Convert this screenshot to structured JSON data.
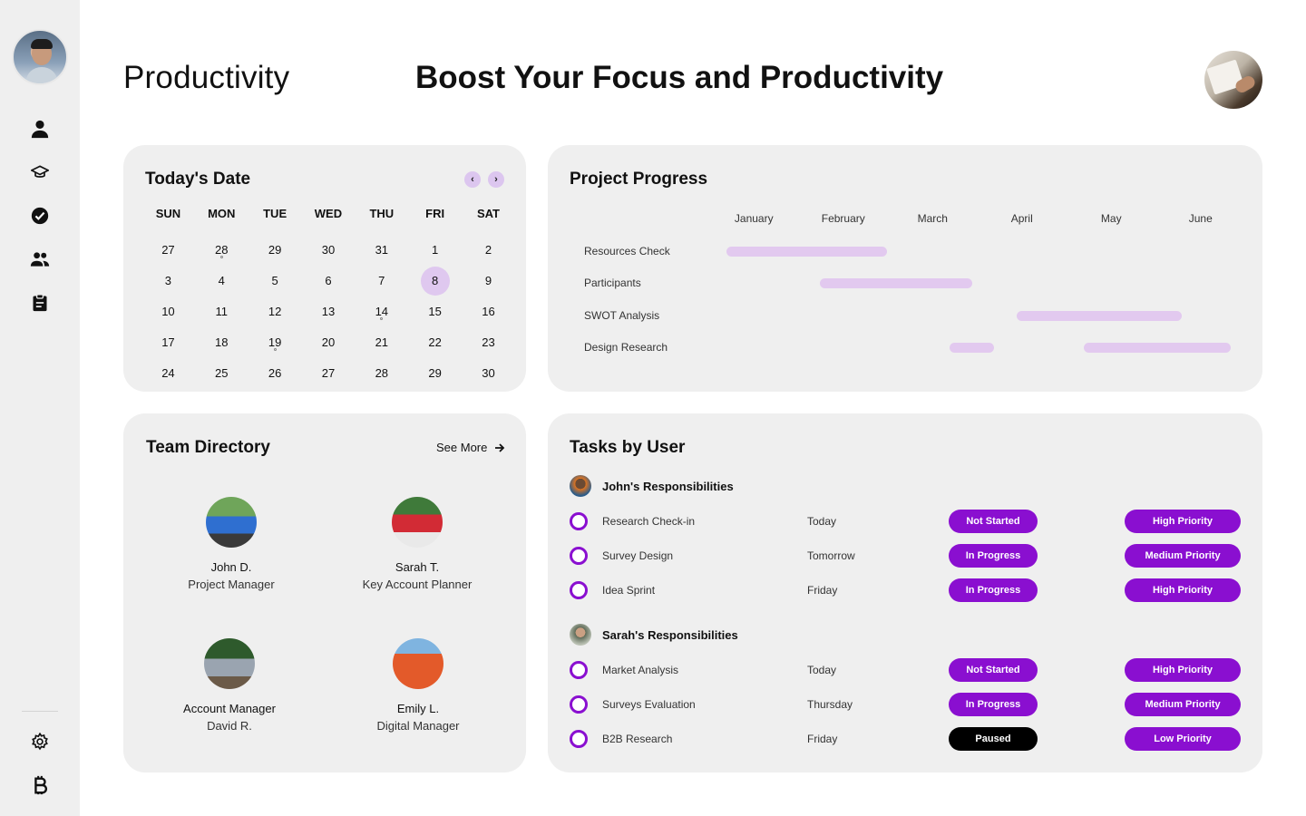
{
  "header": {
    "brand": "Productivity",
    "headline": "Boost Your Focus and Productivity"
  },
  "sidebar": {
    "icons": [
      "user-icon",
      "graduation-cap-icon",
      "check-circle-icon",
      "team-icon",
      "clipboard-icon"
    ],
    "bottom_icons": [
      "gear-icon",
      "bitcoin-icon"
    ]
  },
  "calendar": {
    "title": "Today's Date",
    "prev": "‹",
    "next": "›",
    "weekdays": [
      "SUN",
      "MON",
      "TUE",
      "WED",
      "THU",
      "FRI",
      "SAT"
    ],
    "weeks": [
      [
        "27",
        "28",
        "29",
        "30",
        "31",
        "1",
        "2"
      ],
      [
        "3",
        "4",
        "5",
        "6",
        "7",
        "8",
        "9"
      ],
      [
        "10",
        "11",
        "12",
        "13",
        "14",
        "15",
        "16"
      ],
      [
        "17",
        "18",
        "19",
        "20",
        "21",
        "22",
        "23"
      ],
      [
        "24",
        "25",
        "26",
        "27",
        "28",
        "29",
        "30"
      ]
    ],
    "selected": "8",
    "dotted": [
      [
        0,
        1
      ],
      [
        2,
        4
      ],
      [
        3,
        2
      ]
    ],
    "accent": "#dfc8ef"
  },
  "project_progress": {
    "title": "Project Progress",
    "months": [
      "January",
      "February",
      "March",
      "April",
      "May",
      "June"
    ],
    "tasks": [
      {
        "label": "Resources Check",
        "segments": [
          [
            0.7,
            2.5
          ]
        ]
      },
      {
        "label": "Participants",
        "segments": [
          [
            1.75,
            3.45
          ]
        ]
      },
      {
        "label": "SWOT Analysis",
        "segments": [
          [
            3.95,
            5.8
          ]
        ]
      },
      {
        "label": "Design Research",
        "segments": [
          [
            3.2,
            3.7
          ],
          [
            4.7,
            6.35
          ]
        ]
      }
    ],
    "bar_color": "#e2c9ef"
  },
  "team": {
    "title": "Team Directory",
    "see_more": "See More",
    "members": [
      {
        "line1": "John D.",
        "line2": "Project Manager",
        "photo": "group-blue-shirts"
      },
      {
        "line1": "Sarah T.",
        "line2": "Key Account Planner",
        "photo": "group-red-shirts"
      },
      {
        "line1": "Account Manager",
        "line2": "David R.",
        "photo": "group-outdoor"
      },
      {
        "line1": "Emily L.",
        "line2": "Digital Manager",
        "photo": "group-orange-suits"
      }
    ]
  },
  "tasks": {
    "title": "Tasks by User",
    "users": [
      {
        "name": "John's Responsibilities",
        "items": [
          {
            "task": "Research Check-in",
            "due": "Today",
            "status": "Not Started",
            "priority": "High Priority"
          },
          {
            "task": "Survey Design",
            "due": "Tomorrow",
            "status": "In Progress",
            "priority": "Medium Priority"
          },
          {
            "task": "Idea Sprint",
            "due": "Friday",
            "status": "In Progress",
            "priority": "High Priority"
          }
        ]
      },
      {
        "name": "Sarah's Responsibilities",
        "items": [
          {
            "task": "Market Analysis",
            "due": "Today",
            "status": "Not Started",
            "priority": "High Priority"
          },
          {
            "task": "Surveys Evaluation",
            "due": "Thursday",
            "status": "In Progress",
            "priority": "Medium Priority"
          },
          {
            "task": "B2B Research",
            "due": "Friday",
            "status": "Paused",
            "priority": "Low Priority"
          }
        ]
      }
    ],
    "accent": "#8a0fd0",
    "paused_color": "#000000"
  }
}
